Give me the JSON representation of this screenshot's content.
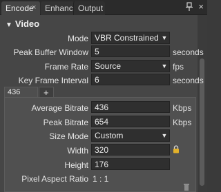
{
  "tabs": [
    {
      "label": "Encode",
      "close": "×"
    },
    {
      "label": "Enhance"
    },
    {
      "label": "Output"
    }
  ],
  "window": {
    "close_glyph": "×",
    "pin_icon": "pin-icon"
  },
  "section": {
    "title": "Video",
    "toggle": "▼"
  },
  "video": {
    "mode": {
      "label": "Mode",
      "value": "VBR Constrained"
    },
    "peak_buffer": {
      "label": "Peak Buffer Window",
      "value": "5",
      "unit": "seconds"
    },
    "frame_rate": {
      "label": "Frame Rate",
      "value": "Source",
      "unit": "fps"
    },
    "key_frame": {
      "label": "Key Frame Interval",
      "value": "6",
      "unit": "seconds"
    }
  },
  "bitrate_tabs": {
    "active": "436 Kbps",
    "add": "+"
  },
  "stream": {
    "avg_bitrate": {
      "label": "Average Bitrate",
      "value": "436",
      "unit": "Kbps"
    },
    "peak_bitrate": {
      "label": "Peak Bitrate",
      "value": "654",
      "unit": "Kbps"
    },
    "size_mode": {
      "label": "Size Mode",
      "value": "Custom"
    },
    "width": {
      "label": "Width",
      "value": "320"
    },
    "height": {
      "label": "Height",
      "value": "176"
    },
    "par": {
      "label": "Pixel Aspect Ratio",
      "value": "1 : 1"
    }
  },
  "colors": {
    "panel": "#464646",
    "field": "#2f2f2f",
    "lock": "#e2b12a"
  }
}
